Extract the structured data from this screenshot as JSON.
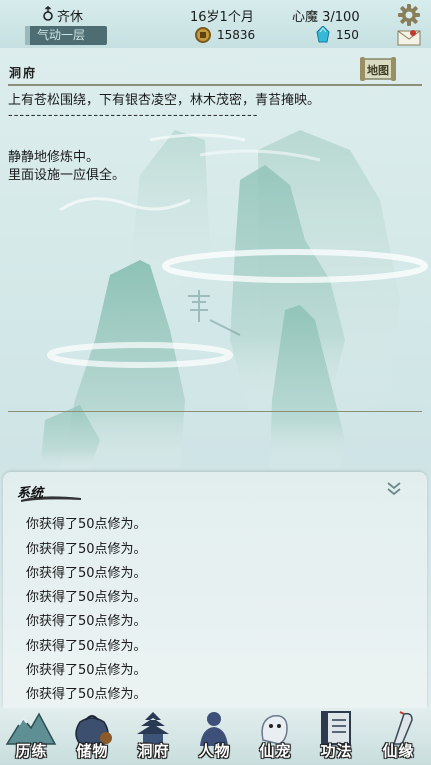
{
  "header": {
    "player_name": "齐休",
    "age": "16岁1个月",
    "heart_demon": "心魔 3/100",
    "realm": "气动一层",
    "coins": "15836",
    "spirit_stones": "150",
    "icons": {
      "gender": "male-icon",
      "settings": "gear-icon",
      "mail": "mail-icon",
      "coin": "coin-icon",
      "stone": "spirit-stone-icon"
    }
  },
  "location": {
    "title": "洞府",
    "map_label": "地图",
    "description": "上有苍松围绕，下有银杏凌空，林木茂密，青苔掩映。",
    "separator": "--------------------------------------------",
    "status": [
      "静静地修炼中。",
      "里面设施一应俱全。"
    ]
  },
  "system": {
    "title": "系统",
    "messages": [
      "你获得了50点修为。",
      "你获得了50点修为。",
      "你获得了50点修为。",
      "你获得了50点修为。",
      "你获得了50点修为。",
      "你获得了50点修为。",
      "你获得了50点修为。",
      "你获得了50点修为。"
    ]
  },
  "nav": [
    {
      "label": "历练",
      "icon": "mountain-icon"
    },
    {
      "label": "储物",
      "icon": "pouch-icon"
    },
    {
      "label": "洞府",
      "icon": "pagoda-icon"
    },
    {
      "label": "人物",
      "icon": "person-icon"
    },
    {
      "label": "仙宠",
      "icon": "spirit-pet-icon"
    },
    {
      "label": "功法",
      "icon": "scroll-icon"
    },
    {
      "label": "仙缘",
      "icon": "crane-icon"
    }
  ],
  "colors": {
    "realm_bg": "#4d6d72",
    "accent_line": "#8a8f7a",
    "mountain": "#8fbfb5"
  }
}
